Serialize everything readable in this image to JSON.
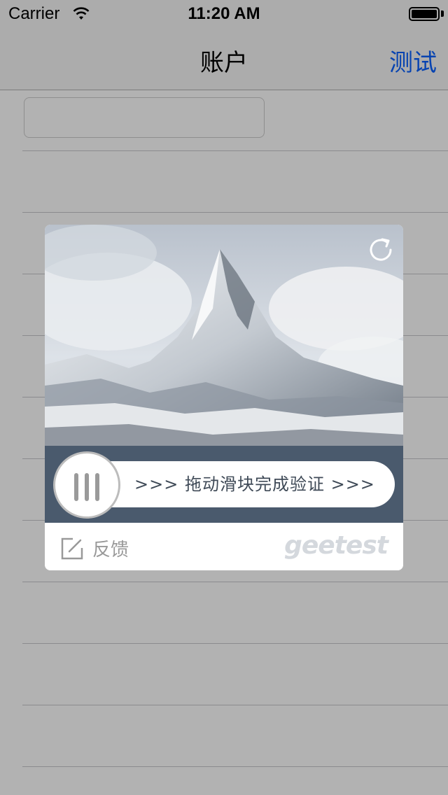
{
  "status_bar": {
    "carrier": "Carrier",
    "time": "11:20 AM"
  },
  "nav_bar": {
    "title": "账户",
    "right_button": "测试"
  },
  "captcha": {
    "slider_hint": ">>> 拖动滑块完成验证 >>>",
    "feedback_label": "反馈",
    "brand": "geetest",
    "icons": [
      "refresh-icon",
      "edit-icon",
      "slider-grip-icon"
    ]
  }
}
